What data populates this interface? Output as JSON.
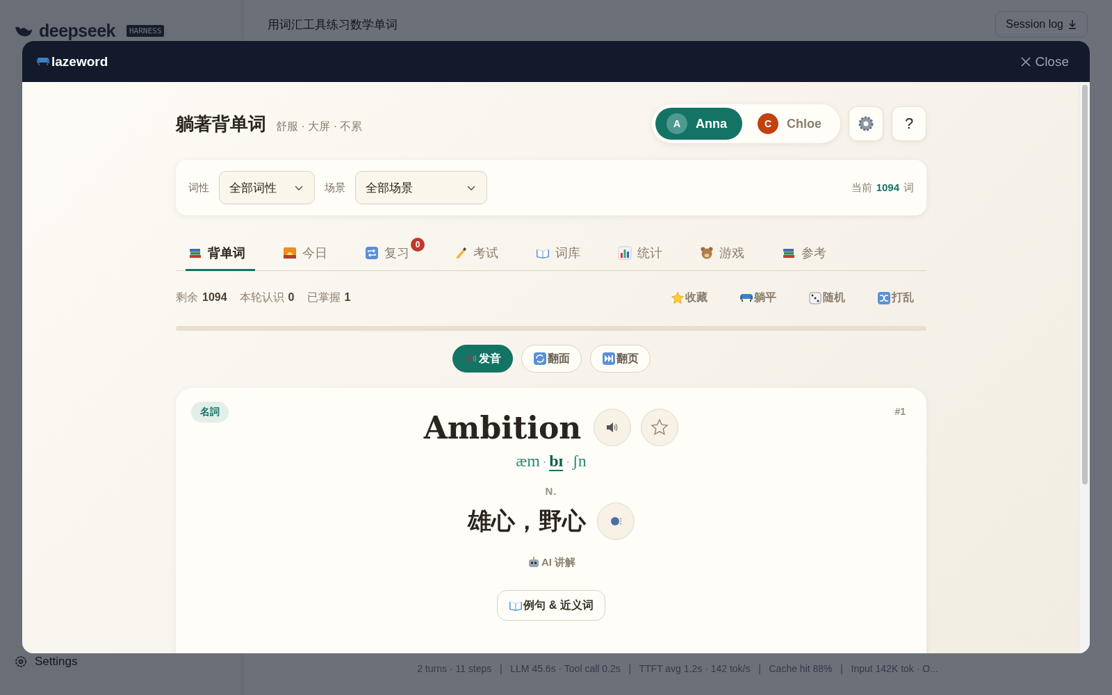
{
  "background": {
    "sidebar": {
      "logo": "deepseek",
      "badge": "HARNESS",
      "settings": "Settings"
    },
    "header": {
      "title": "用词汇工具练习数学单词",
      "session_button": "Session log"
    },
    "status_bar": "2 turns · 11 steps   |   LLM 45.6s · Tool call 0.2s   |   TTFT avg 1.2s · 142 tok/s   |   Cache hit 88%   |   Input 142K tok · O..."
  },
  "modal": {
    "title": "lazeword",
    "close": "Close",
    "app_title": "躺著背单词",
    "subtitle": "舒服 · 大屏 · 不累",
    "users": [
      {
        "initial": "A",
        "name": "Anna",
        "selected": true,
        "color": "#4f9a90"
      },
      {
        "initial": "C",
        "name": "Chloe",
        "selected": false,
        "color": "#c2410c"
      }
    ],
    "help": "?",
    "filters": [
      {
        "label": "词性",
        "value": "全部词性"
      },
      {
        "label": "场景",
        "value": "全部场景"
      }
    ],
    "count": {
      "prefix": "当前",
      "value": "1094",
      "suffix": "词"
    },
    "tabs": [
      {
        "label": "背单词",
        "selected": true
      },
      {
        "label": "今日",
        "selected": false
      },
      {
        "label": "复习",
        "selected": false,
        "badge": "0"
      },
      {
        "label": "考试",
        "selected": false
      },
      {
        "label": "词库",
        "selected": false
      },
      {
        "label": "统计",
        "selected": false
      },
      {
        "label": "游戏",
        "selected": false
      },
      {
        "label": "参考",
        "selected": false
      }
    ],
    "stats": [
      {
        "label": "剩余",
        "value": "1094"
      },
      {
        "label": "本轮认识",
        "value": "0"
      },
      {
        "label": "已掌握",
        "value": "1"
      }
    ],
    "actions": [
      "收藏",
      "躺平",
      "随机",
      "打乱"
    ],
    "progress": {
      "level": 0
    },
    "modes": [
      {
        "label": "发音",
        "selected": true
      },
      {
        "label": "翻面",
        "selected": false
      },
      {
        "label": "翻页",
        "selected": false
      }
    ],
    "card": {
      "tag": "名詞",
      "index": "#1",
      "word": "Ambition",
      "starred": false,
      "phonetic": [
        {
          "text": "æm",
          "kind": "syllable",
          "stressed": false
        },
        {
          "text": "·",
          "kind": "separator"
        },
        {
          "text": "bɪ",
          "kind": "syllable",
          "stressed": true
        },
        {
          "text": "·",
          "kind": "separator"
        },
        {
          "text": "ʃn",
          "kind": "syllable",
          "stressed": false
        }
      ],
      "pos": "N.",
      "meaning": "雄心，野心",
      "ai": "AI 讲解",
      "examples_button": "例句 & 近义词"
    }
  }
}
